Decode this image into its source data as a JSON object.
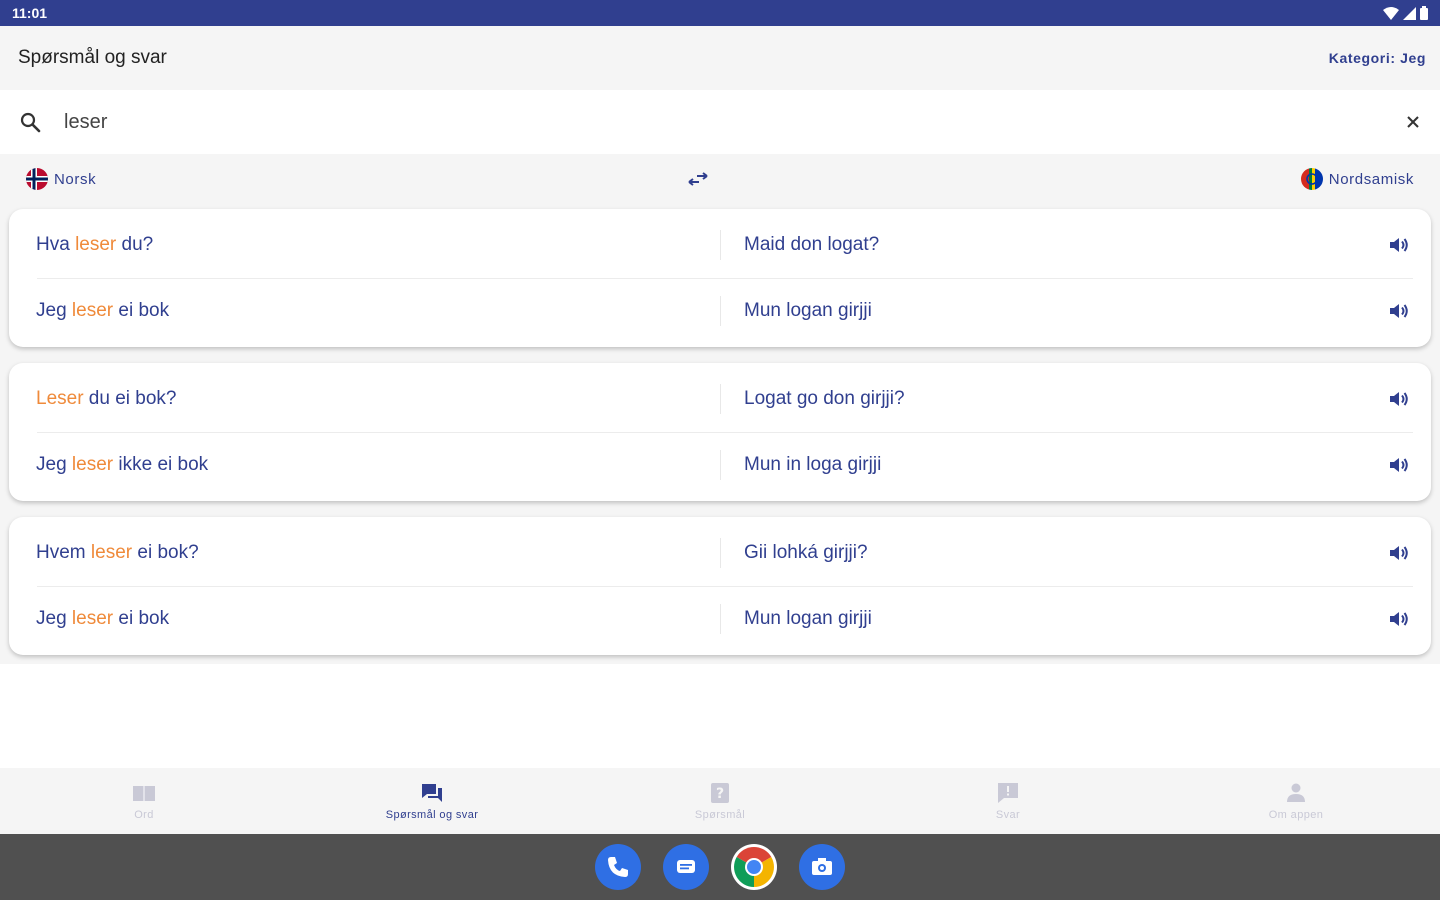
{
  "status": {
    "time": "11:01"
  },
  "appbar": {
    "title": "Spørsmål og svar",
    "category": "Kategori: Jeg"
  },
  "search": {
    "value": "leser",
    "placeholder": ""
  },
  "languages": {
    "left": "Norsk",
    "right": "Nordsamisk"
  },
  "cards": [
    {
      "q": {
        "no": [
          "Hva ",
          "leser",
          " du?"
        ],
        "se": "Maid don logat?"
      },
      "a": {
        "no": [
          "Jeg ",
          "leser",
          " ei bok"
        ],
        "se": "Mun logan girjji"
      }
    },
    {
      "q": {
        "no": [
          "",
          "Leser",
          " du ei bok?"
        ],
        "se": "Logat go don girjji?"
      },
      "a": {
        "no": [
          "Jeg ",
          "leser",
          " ikke ei bok"
        ],
        "se": "Mun in loga girjji"
      }
    },
    {
      "q": {
        "no": [
          "Hvem ",
          "leser",
          " ei bok?"
        ],
        "se": "Gii lohká girjji?"
      },
      "a": {
        "no": [
          "Jeg ",
          "leser",
          " ei bok"
        ],
        "se": "Mun logan girjji"
      }
    }
  ],
  "nav": [
    {
      "label": "Ord",
      "icon": "book-icon",
      "active": false
    },
    {
      "label": "Spørsmål og svar",
      "icon": "chat-icon",
      "active": true
    },
    {
      "label": "Spørsmål",
      "icon": "question-icon",
      "active": false
    },
    {
      "label": "Svar",
      "icon": "answer-icon",
      "active": false
    },
    {
      "label": "Om appen",
      "icon": "person-icon",
      "active": false
    }
  ],
  "colors": {
    "primary": "#303f8f",
    "highlight": "#ef8a3a",
    "statusbar": "#303f8f",
    "systembar": "#505050"
  },
  "dock": [
    "phone-icon",
    "messages-icon",
    "chrome-icon",
    "camera-icon"
  ]
}
